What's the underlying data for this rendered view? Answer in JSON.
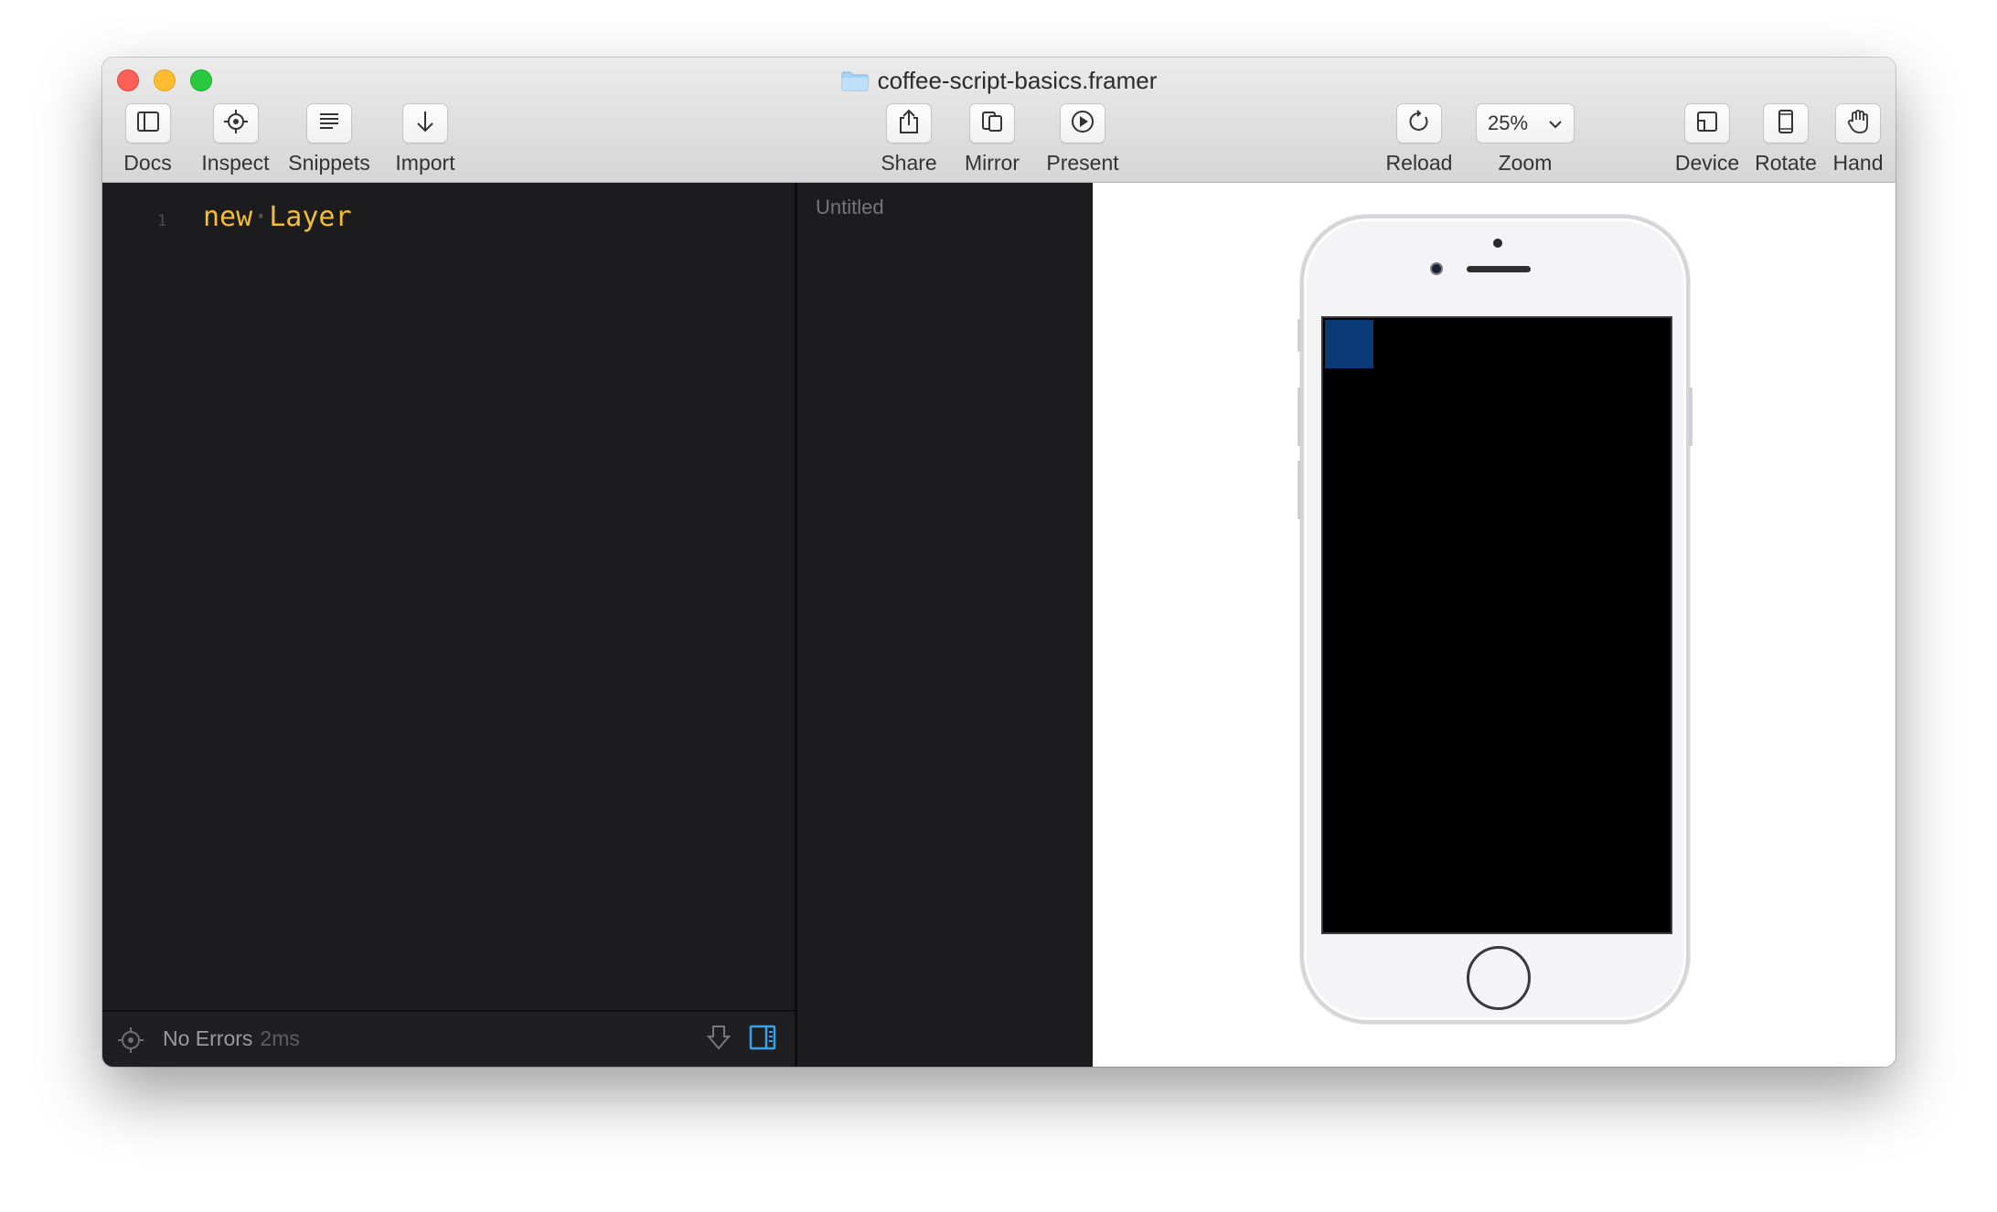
{
  "window": {
    "title": "coffee-script-basics.framer",
    "folder_icon": "folder-icon"
  },
  "toolbar": {
    "left": [
      {
        "label": "Docs",
        "icon": "sidebar-icon"
      },
      {
        "label": "Inspect",
        "icon": "crosshair-icon"
      },
      {
        "label": "Snippets",
        "icon": "lines-icon"
      },
      {
        "label": "Import",
        "icon": "arrow-down-icon"
      }
    ],
    "center": [
      {
        "label": "Share",
        "icon": "share-icon"
      },
      {
        "label": "Mirror",
        "icon": "mirror-icon"
      },
      {
        "label": "Present",
        "icon": "play-icon"
      }
    ],
    "reload": {
      "label": "Reload",
      "icon": "reload-icon"
    },
    "zoom": {
      "label": "Zoom",
      "value": "25%",
      "icon": "chevron-down-icon"
    },
    "right": [
      {
        "label": "Device",
        "icon": "device-icon"
      },
      {
        "label": "Rotate",
        "icon": "rotate-icon"
      },
      {
        "label": "Hand",
        "icon": "hand-icon"
      }
    ]
  },
  "editor": {
    "lines": [
      {
        "number": "1",
        "keyword": "new",
        "separator": "·",
        "identifier": "Layer"
      }
    ],
    "status": {
      "text": "No Errors",
      "time": "2ms"
    }
  },
  "layers_panel": {
    "title": "Untitled"
  },
  "preview": {
    "device": "iphone",
    "layer_color": "#0b3a78"
  },
  "colors": {
    "code_yellow": "#f3be32",
    "accent_blue": "#3aa0e8",
    "editor_bg": "#1c1c1e"
  }
}
